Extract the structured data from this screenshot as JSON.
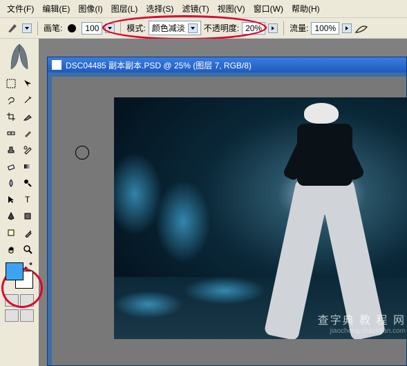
{
  "menu": {
    "file": "文件(F)",
    "edit": "编辑(E)",
    "image": "图像(I)",
    "layer": "图层(L)",
    "select": "选择(S)",
    "filter": "滤镜(T)",
    "view": "视图(V)",
    "window": "窗口(W)",
    "help": "帮助(H)"
  },
  "options": {
    "brush_label": "画笔:",
    "brush_size": "100",
    "mode_label": "模式:",
    "mode_value": "颜色减淡",
    "opacity_label": "不透明度:",
    "opacity_value": "20%",
    "flow_label": "流量:",
    "flow_value": "100%"
  },
  "document": {
    "title": "DSC04485 副本副本.PSD @ 25% (图层 7, RGB/8)"
  },
  "swatches": {
    "foreground": "#3ea4f2",
    "background": "#ffffff"
  },
  "watermark": {
    "main": "查字典 教 程 网",
    "sub": "jiaocheng.chazidian.com"
  },
  "tools": {
    "row1a": "marquee",
    "row1b": "move",
    "row2a": "lasso",
    "row2b": "wand",
    "row3a": "crop",
    "row3b": "slice",
    "row4a": "heal",
    "row4b": "brush",
    "row5a": "stamp",
    "row5b": "history",
    "row6a": "eraser",
    "row6b": "gradient",
    "row7a": "blur",
    "row7b": "dodge",
    "row8a": "path",
    "row8b": "type",
    "row9a": "pen",
    "row9b": "shape",
    "row10a": "notes",
    "row10b": "eyedrop",
    "row11a": "hand",
    "row11b": "zoom"
  }
}
